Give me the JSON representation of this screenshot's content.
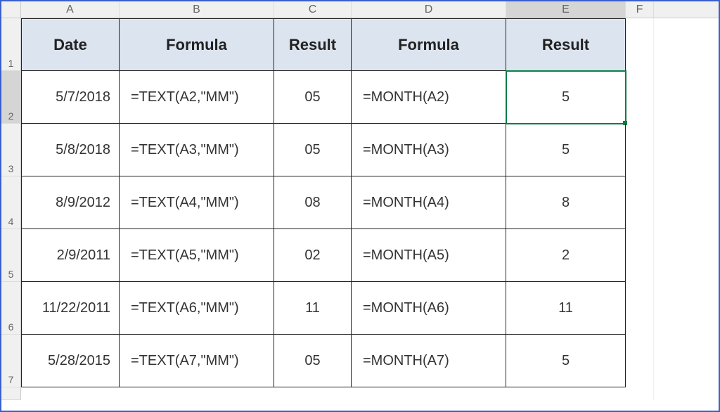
{
  "columns": [
    "A",
    "B",
    "C",
    "D",
    "E",
    "F"
  ],
  "headers": {
    "A": "Date",
    "B": "Formula",
    "C": "Result",
    "D": "Formula",
    "E": "Result"
  },
  "rows": [
    {
      "num": "2",
      "A": "5/7/2018",
      "B": "=TEXT(A2,\"MM\")",
      "C": "05",
      "D": "=MONTH(A2)",
      "E": "5"
    },
    {
      "num": "3",
      "A": "5/8/2018",
      "B": "=TEXT(A3,\"MM\")",
      "C": "05",
      "D": "=MONTH(A3)",
      "E": "5"
    },
    {
      "num": "4",
      "A": "8/9/2012",
      "B": "=TEXT(A4,\"MM\")",
      "C": "08",
      "D": "=MONTH(A4)",
      "E": "8"
    },
    {
      "num": "5",
      "A": "2/9/2011",
      "B": "=TEXT(A5,\"MM\")",
      "C": "02",
      "D": "=MONTH(A5)",
      "E": "2"
    },
    {
      "num": "6",
      "A": "11/22/2011",
      "B": "=TEXT(A6,\"MM\")",
      "C": "11",
      "D": "=MONTH(A6)",
      "E": "11"
    },
    {
      "num": "7",
      "A": "5/28/2015",
      "B": "=TEXT(A7,\"MM\")",
      "C": "05",
      "D": "=MONTH(A7)",
      "E": "5"
    }
  ],
  "row1_label": "1",
  "selected_cell": "E2",
  "chart_data": {
    "type": "table",
    "title": "Excel TEXT vs MONTH function comparison",
    "columns": [
      "Date",
      "Formula",
      "Result",
      "Formula",
      "Result"
    ],
    "rows": [
      [
        "5/7/2018",
        "=TEXT(A2,\"MM\")",
        "05",
        "=MONTH(A2)",
        "5"
      ],
      [
        "5/8/2018",
        "=TEXT(A3,\"MM\")",
        "05",
        "=MONTH(A3)",
        "5"
      ],
      [
        "8/9/2012",
        "=TEXT(A4,\"MM\")",
        "08",
        "=MONTH(A4)",
        "8"
      ],
      [
        "2/9/2011",
        "=TEXT(A5,\"MM\")",
        "02",
        "=MONTH(A5)",
        "2"
      ],
      [
        "11/22/2011",
        "=TEXT(A6,\"MM\")",
        "11",
        "=MONTH(A6)",
        "11"
      ],
      [
        "5/28/2015",
        "=TEXT(A7,\"MM\")",
        "05",
        "=MONTH(A7)",
        "5"
      ]
    ]
  }
}
